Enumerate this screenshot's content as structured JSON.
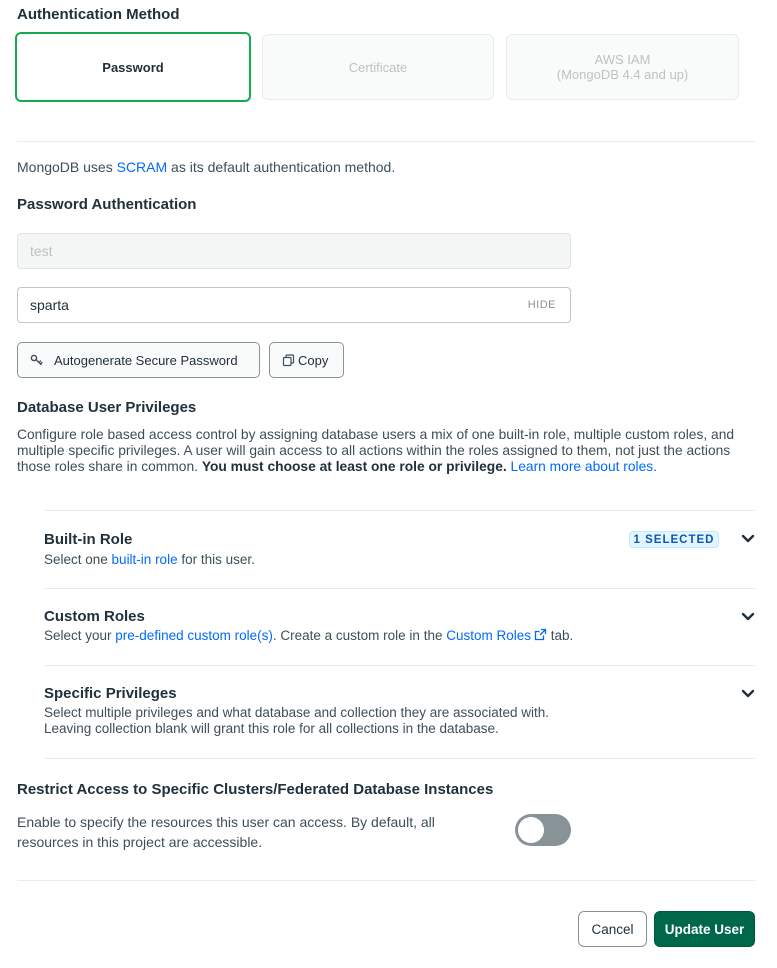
{
  "auth_method": {
    "title": "Authentication Method",
    "options": [
      {
        "label": "Password"
      },
      {
        "label": "Certificate"
      },
      {
        "label_line1": "AWS IAM",
        "label_line2": "(MongoDB 4.4 and up)"
      }
    ]
  },
  "scram_note": {
    "prefix": "MongoDB uses ",
    "link": "SCRAM",
    "suffix": " as its default authentication method."
  },
  "password_auth": {
    "title": "Password Authentication",
    "username_value": "test",
    "password_value": "sparta",
    "hide_label": "HIDE",
    "autogenerate_label": "Autogenerate Secure Password",
    "copy_label": "Copy"
  },
  "privileges": {
    "title": "Database User Privileges",
    "desc_part1": "Configure role based access control by assigning database users a mix of one built-in role, multiple custom roles, and multiple specific privileges. A user will gain access to all actions within the roles assigned to them, not just the actions those roles share in common. ",
    "desc_bold": "You must choose at least one role or privilege.",
    "desc_link": "Learn more about roles.",
    "rows": [
      {
        "title": "Built-in Role",
        "desc_prefix": "Select one ",
        "desc_link": "built-in role",
        "desc_suffix": " for this user.",
        "badge": "1 SELECTED"
      },
      {
        "title": "Custom Roles",
        "desc_prefix": "Select your ",
        "desc_link": "pre-defined custom role(s)",
        "desc_middle": ". Create a custom role in the ",
        "desc_link2": "Custom Roles",
        "desc_suffix": " tab."
      },
      {
        "title": "Specific Privileges",
        "desc_line1": "Select multiple privileges and what database and collection they are associated with.",
        "desc_line2": "Leaving collection blank will grant this role for all collections in the database."
      }
    ]
  },
  "restrict": {
    "title": "Restrict Access to Specific Clusters/Federated Database Instances",
    "desc": "Enable to specify the resources this user can access. By default, all resources in this project are accessible.",
    "enabled": false
  },
  "footer": {
    "cancel_label": "Cancel",
    "update_label": "Update User"
  },
  "colors": {
    "accent_green": "#13aa52",
    "primary_button": "#00684a",
    "link_blue": "#016bf8",
    "badge_bg": "#e1f7ff"
  }
}
